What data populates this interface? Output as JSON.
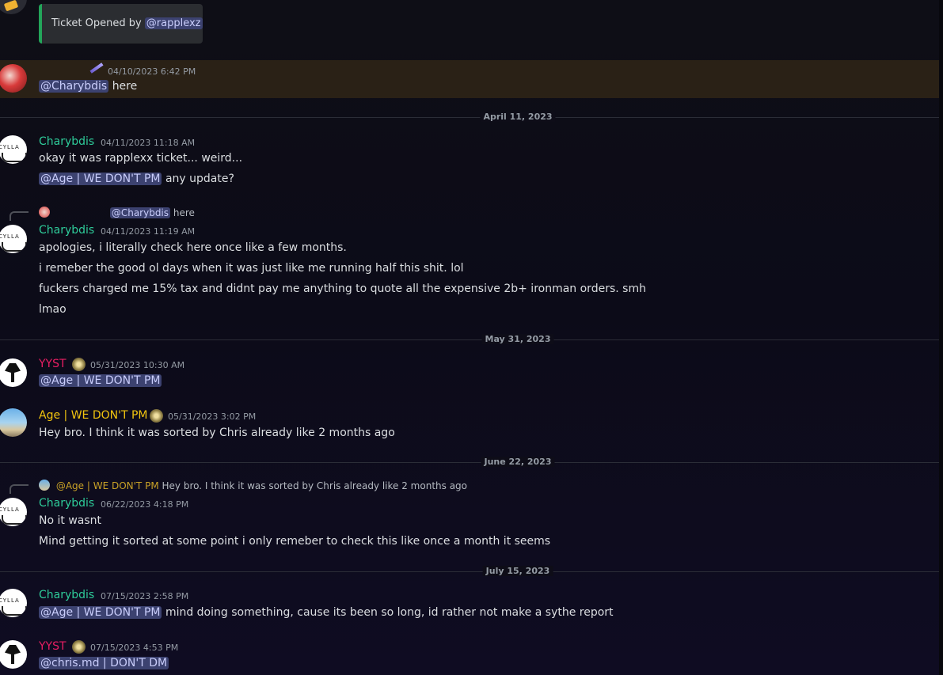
{
  "colors": {
    "charybdis": "#2ecc9a",
    "yyst": "#e91e63",
    "age": "#f1c40f",
    "mention_bg": "#3c4270",
    "embed_accent": "#23a55a"
  },
  "embed": {
    "text": "Ticket Opened by",
    "mention": "@rapplexz"
  },
  "msg1": {
    "timestamp": "04/10/2023 6:42 PM",
    "mention": "@Charybdis",
    "text": "here"
  },
  "dividers": [
    "April 11, 2023",
    "May 31, 2023",
    "June 22, 2023",
    "July 15, 2023"
  ],
  "msg2": {
    "author": "Charybdis",
    "timestamp": "04/11/2023 11:18 AM",
    "line1": "okay it was rapplexx ticket... weird...",
    "mention": "@Age | WE DON'T PM",
    "line2": "any update?"
  },
  "msg3": {
    "reply_mention": "@Charybdis",
    "reply_text": "here",
    "author": "Charybdis",
    "timestamp": "04/11/2023 11:19 AM",
    "lines": [
      "apologies, i literally check here once like a few months.",
      "i remeber the good ol days when it was just like me running half this shit. lol",
      "fuckers charged me 15% tax and didnt pay me anything to quote all the expensive 2b+ ironman orders. smh",
      "lmao"
    ]
  },
  "msg4": {
    "author": "YYST",
    "timestamp": "05/31/2023 10:30 AM",
    "mention": "@Age | WE DON'T PM"
  },
  "msg5": {
    "author": "Age | WE DON'T PM",
    "timestamp": "05/31/2023 3:02 PM",
    "text": "Hey bro. I think it was sorted by Chris already like 2 months ago"
  },
  "msg6": {
    "reply_author": "@Age | WE DON'T PM",
    "reply_text": "Hey bro. I think it was sorted by Chris already like 2 months ago",
    "author": "Charybdis",
    "timestamp": "06/22/2023 4:18 PM",
    "line1": "No it wasnt",
    "line2": "Mind getting it sorted at some point i only remeber to check this like once a month it seems"
  },
  "msg7": {
    "author": "Charybdis",
    "timestamp": "07/15/2023 2:58 PM",
    "mention": "@Age | WE DON'T PM",
    "text": "mind doing something, cause its been so long, id rather not make a sythe report"
  },
  "msg8": {
    "author": "YYST",
    "timestamp": "07/15/2023 4:53 PM",
    "mention": "@chris.md | DON'T DM"
  },
  "avatar_label": "CYLLA"
}
